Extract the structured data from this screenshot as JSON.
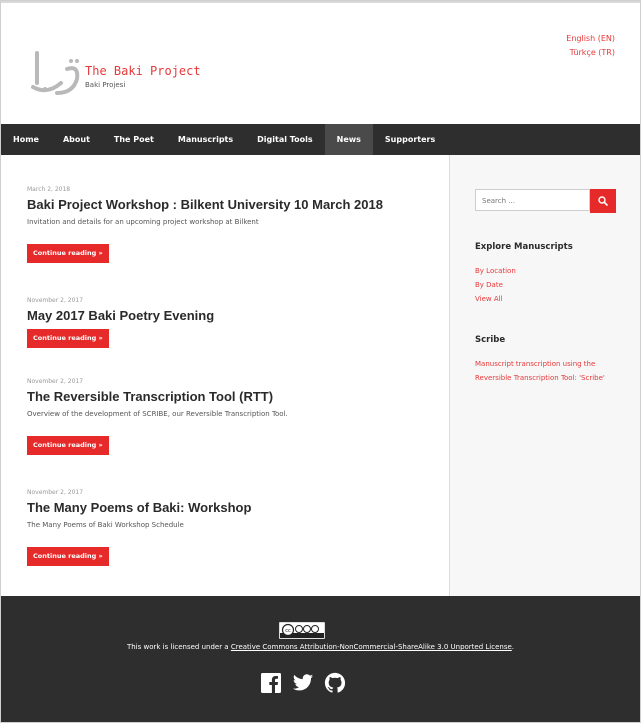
{
  "header": {
    "site_title": "The Baki Project",
    "site_tagline": "Baki Projesi",
    "languages": [
      {
        "label": "English (EN)"
      },
      {
        "label": "Türkçe (TR)"
      }
    ]
  },
  "nav": {
    "items": [
      {
        "label": "Home"
      },
      {
        "label": "About"
      },
      {
        "label": "The Poet"
      },
      {
        "label": "Manuscripts"
      },
      {
        "label": "Digital Tools"
      },
      {
        "label": "News"
      },
      {
        "label": "Supporters"
      }
    ],
    "active": "News"
  },
  "posts": [
    {
      "date": "March 2, 2018",
      "title": "Baki Project Workshop : Bilkent University 10 March 2018",
      "excerpt": "Invitation and details for an upcoming project workshop at Bilkent",
      "button": "Continue reading »"
    },
    {
      "date": "November 2, 2017",
      "title": "May 2017 Baki Poetry Evening",
      "excerpt": "",
      "button": "Continue reading »"
    },
    {
      "date": "November 2, 2017",
      "title": "The Reversible Transcription Tool (RTT)",
      "excerpt": "Overview of the development of SCRIBE, our Reversible Transcription Tool.",
      "button": "Continue reading »"
    },
    {
      "date": "November 2, 2017",
      "title": "The Many Poems of Baki: Workshop",
      "excerpt": "The Many Poems of Baki Workshop Schedule",
      "button": "Continue reading »"
    }
  ],
  "sidebar": {
    "search_placeholder": "Search ...",
    "explore": {
      "title": "Explore Manuscripts",
      "links": [
        "By Location",
        "By Date",
        "View All"
      ]
    },
    "scribe": {
      "title": "Scribe",
      "link_line1": "Manuscript transcription using the",
      "link_line2": "Reversible Transcription Tool: 'Scribe'"
    }
  },
  "footer": {
    "license_prefix": "This work is licensed under a ",
    "license_link": "Creative Commons Attribution-NonCommercial-ShareAlike 3.0 Unported License",
    "license_suffix": ".",
    "social_icons": [
      "facebook-icon",
      "twitter-icon",
      "github-icon"
    ]
  },
  "colors": {
    "accent": "#e62a2a",
    "nav_bg": "#2e2e2e",
    "footer_bg": "#2e2e2e",
    "sidebar_bg": "#f7f7f7"
  }
}
